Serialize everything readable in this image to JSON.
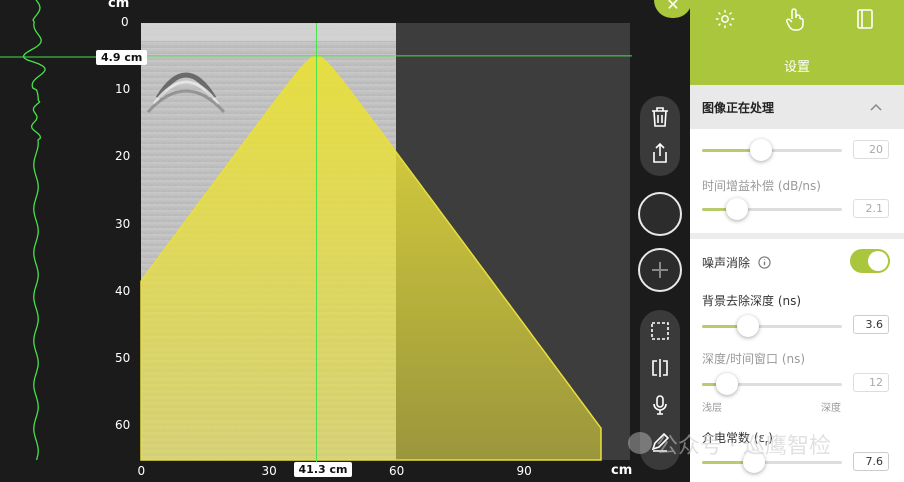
{
  "scan": {
    "y_unit": "cm",
    "x_unit": "cm",
    "y_ticks": [
      "0",
      "10",
      "20",
      "30",
      "40",
      "50",
      "60"
    ],
    "x_ticks": [
      "0",
      "30",
      "60",
      "90"
    ],
    "depth_readout": "4.9 cm",
    "position_readout": "41.3 cm",
    "cursor_depth_cm": 4.9,
    "cursor_position_cm": 41.3,
    "hyperbola_fit_colour": "#e8df3c",
    "cursor_colour": "#46e24a"
  },
  "toolbar": {
    "icons": [
      "trash-icon",
      "share-icon",
      "record-button",
      "add-button",
      "select-region-icon",
      "split-view-icon",
      "microphone-icon",
      "pencil-icon"
    ]
  },
  "panel": {
    "title": "设置",
    "header_icons": [
      "gear-icon",
      "touch-icon",
      "notebook-icon"
    ],
    "section_title": "图像正在处理",
    "sliders": {
      "gain": {
        "value": "20",
        "level": 0.42
      },
      "tgc": {
        "label": "时间增益补偿 (dB/ns)",
        "value": "2.1",
        "level": 0.25
      },
      "bg_removal": {
        "label": "背景去除深度 (ns)",
        "value": "3.6",
        "level": 0.33
      },
      "window": {
        "label": "深度/时间窗口 (ns)",
        "value": "12",
        "level": 0.18,
        "min_label": "浅层",
        "max_label": "深度"
      },
      "dielectric": {
        "label": "介电常数 (ε",
        "label_sub": "r",
        "label_tail": ")",
        "value": "7.6",
        "level": 0.37
      }
    },
    "noise_toggle": {
      "label": "噪声消除",
      "on": true
    }
  },
  "watermark": "公众号 · 巡鹰智检",
  "colors": {
    "accent": "#a9c63d",
    "panel_bg": "#f2f2f2",
    "app_bg": "#1b1b1b"
  }
}
